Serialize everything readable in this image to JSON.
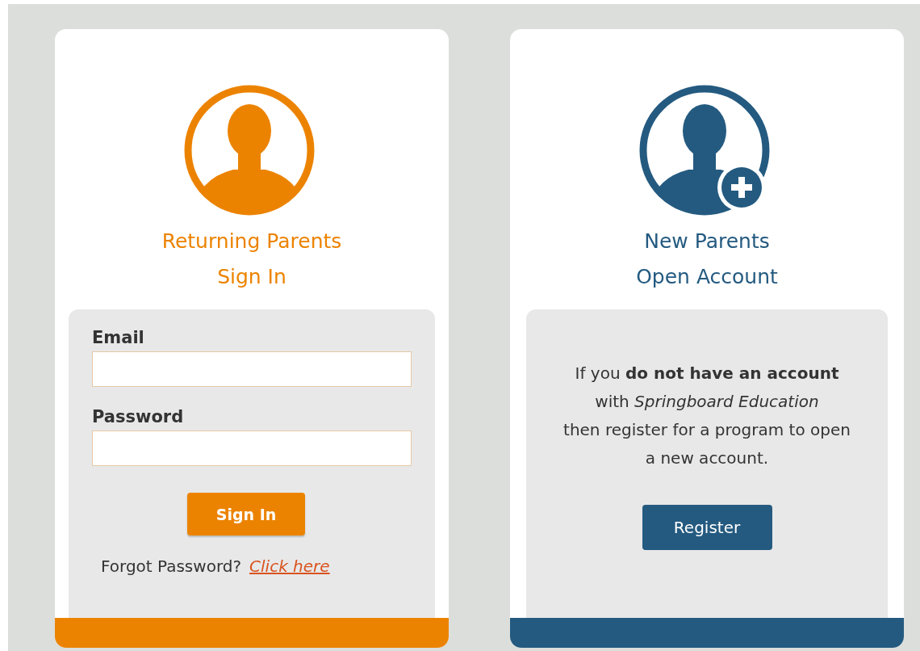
{
  "cards": [
    {
      "kind": "signin",
      "color": "#ec8300",
      "title_lines": [
        "Returning Parents",
        "Sign In"
      ],
      "fields": [
        {
          "label": "Email"
        },
        {
          "label": "Password"
        }
      ],
      "button": "Sign In",
      "forgot": {
        "text": "Forgot Password?",
        "link": "Click here"
      }
    },
    {
      "kind": "register",
      "color": "#245a80",
      "title_lines": [
        "New Parents",
        "Open Account"
      ],
      "message_lines": [
        "If you **do not have an account**",
        "with *Springboard Education*",
        "then register for a program to open",
        "a new account."
      ],
      "button": "Register"
    }
  ]
}
